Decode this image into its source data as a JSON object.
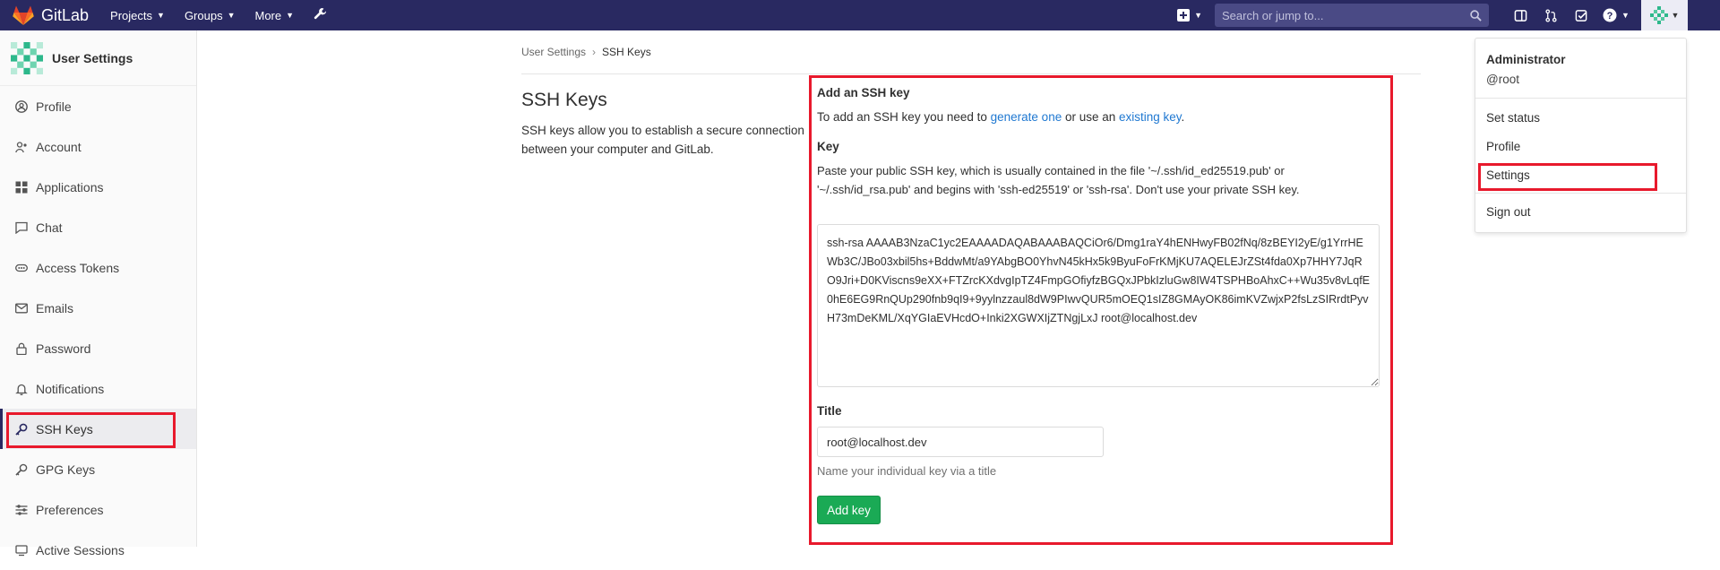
{
  "navbar": {
    "brand": "GitLab",
    "menu": [
      {
        "label": "Projects"
      },
      {
        "label": "Groups"
      },
      {
        "label": "More"
      }
    ],
    "search_placeholder": "Search or jump to...",
    "icons": [
      "plus-icon",
      "sidebar-toggle-icon",
      "merge-request-icon",
      "todo-check-icon",
      "help-icon",
      "avatar-icon"
    ]
  },
  "sidebar": {
    "title": "User Settings",
    "items": [
      {
        "label": "Profile",
        "icon": "profile-icon"
      },
      {
        "label": "Account",
        "icon": "account-icon"
      },
      {
        "label": "Applications",
        "icon": "applications-icon"
      },
      {
        "label": "Chat",
        "icon": "chat-icon"
      },
      {
        "label": "Access Tokens",
        "icon": "token-icon"
      },
      {
        "label": "Emails",
        "icon": "mail-icon"
      },
      {
        "label": "Password",
        "icon": "lock-icon"
      },
      {
        "label": "Notifications",
        "icon": "bell-icon"
      },
      {
        "label": "SSH Keys",
        "icon": "key-icon",
        "active": true
      },
      {
        "label": "GPG Keys",
        "icon": "key-icon"
      },
      {
        "label": "Preferences",
        "icon": "sliders-icon"
      },
      {
        "label": "Active Sessions",
        "icon": "sessions-icon"
      }
    ]
  },
  "breadcrumb": {
    "parent": "User Settings",
    "separator": "›",
    "current": "SSH Keys"
  },
  "page": {
    "title": "SSH Keys",
    "description": "SSH keys allow you to establish a secure connection between your computer and GitLab."
  },
  "form": {
    "heading": "Add an SSH key",
    "intro_prefix": "To add an SSH key you need to ",
    "intro_link1": "generate one",
    "intro_middle": " or use an ",
    "intro_link2": "existing key",
    "intro_suffix": ".",
    "key_label": "Key",
    "key_help": "Paste your public SSH key, which is usually contained in the file '~/.ssh/id_ed25519.pub' or '~/.ssh/id_rsa.pub' and begins with 'ssh-ed25519' or 'ssh-rsa'. Don't use your private SSH key.",
    "key_value": "ssh-rsa AAAAB3NzaC1yc2EAAAADAQABAAABAQCiOr6/Dmg1raY4hENHwyFB02fNq/8zBEYI2yE/g1YrrHEWb3C/JBo03xbil5hs+BddwMt/a9YAbgBO0YhvN45kHx5k9ByuFoFrKMjKU7AQELEJrZSt4fda0Xp7HHY7JqRO9Jri+D0KViscns9eXX+FTZrcKXdvgIpTZ4FmpGOfiyfzBGQxJPbkIzluGw8IW4TSPHBoAhxC++Wu35v8vLqfE0hE6EG9RnQUp290fnb9qI9+9yylnzzaul8dW9PIwvQUR5mOEQ1sIZ8GMAyOK86imKVZwjxP2fsLzSIRrdtPyvH73mDeKML/XqYGIaEVHcdO+Inki2XGWXIjZTNgjLxJ root@localhost.dev",
    "title_label": "Title",
    "title_value": "root@localhost.dev",
    "title_help": "Name your individual key via a title",
    "submit_label": "Add key"
  },
  "user_dropdown": {
    "name": "Administrator",
    "username": "@root",
    "items": [
      "Set status",
      "Profile",
      "Settings",
      "Sign out"
    ]
  },
  "colors": {
    "navbar_bg": "#292961",
    "highlight": "#e8192c",
    "button_green": "#1aaa55",
    "link": "#1f78d1"
  }
}
